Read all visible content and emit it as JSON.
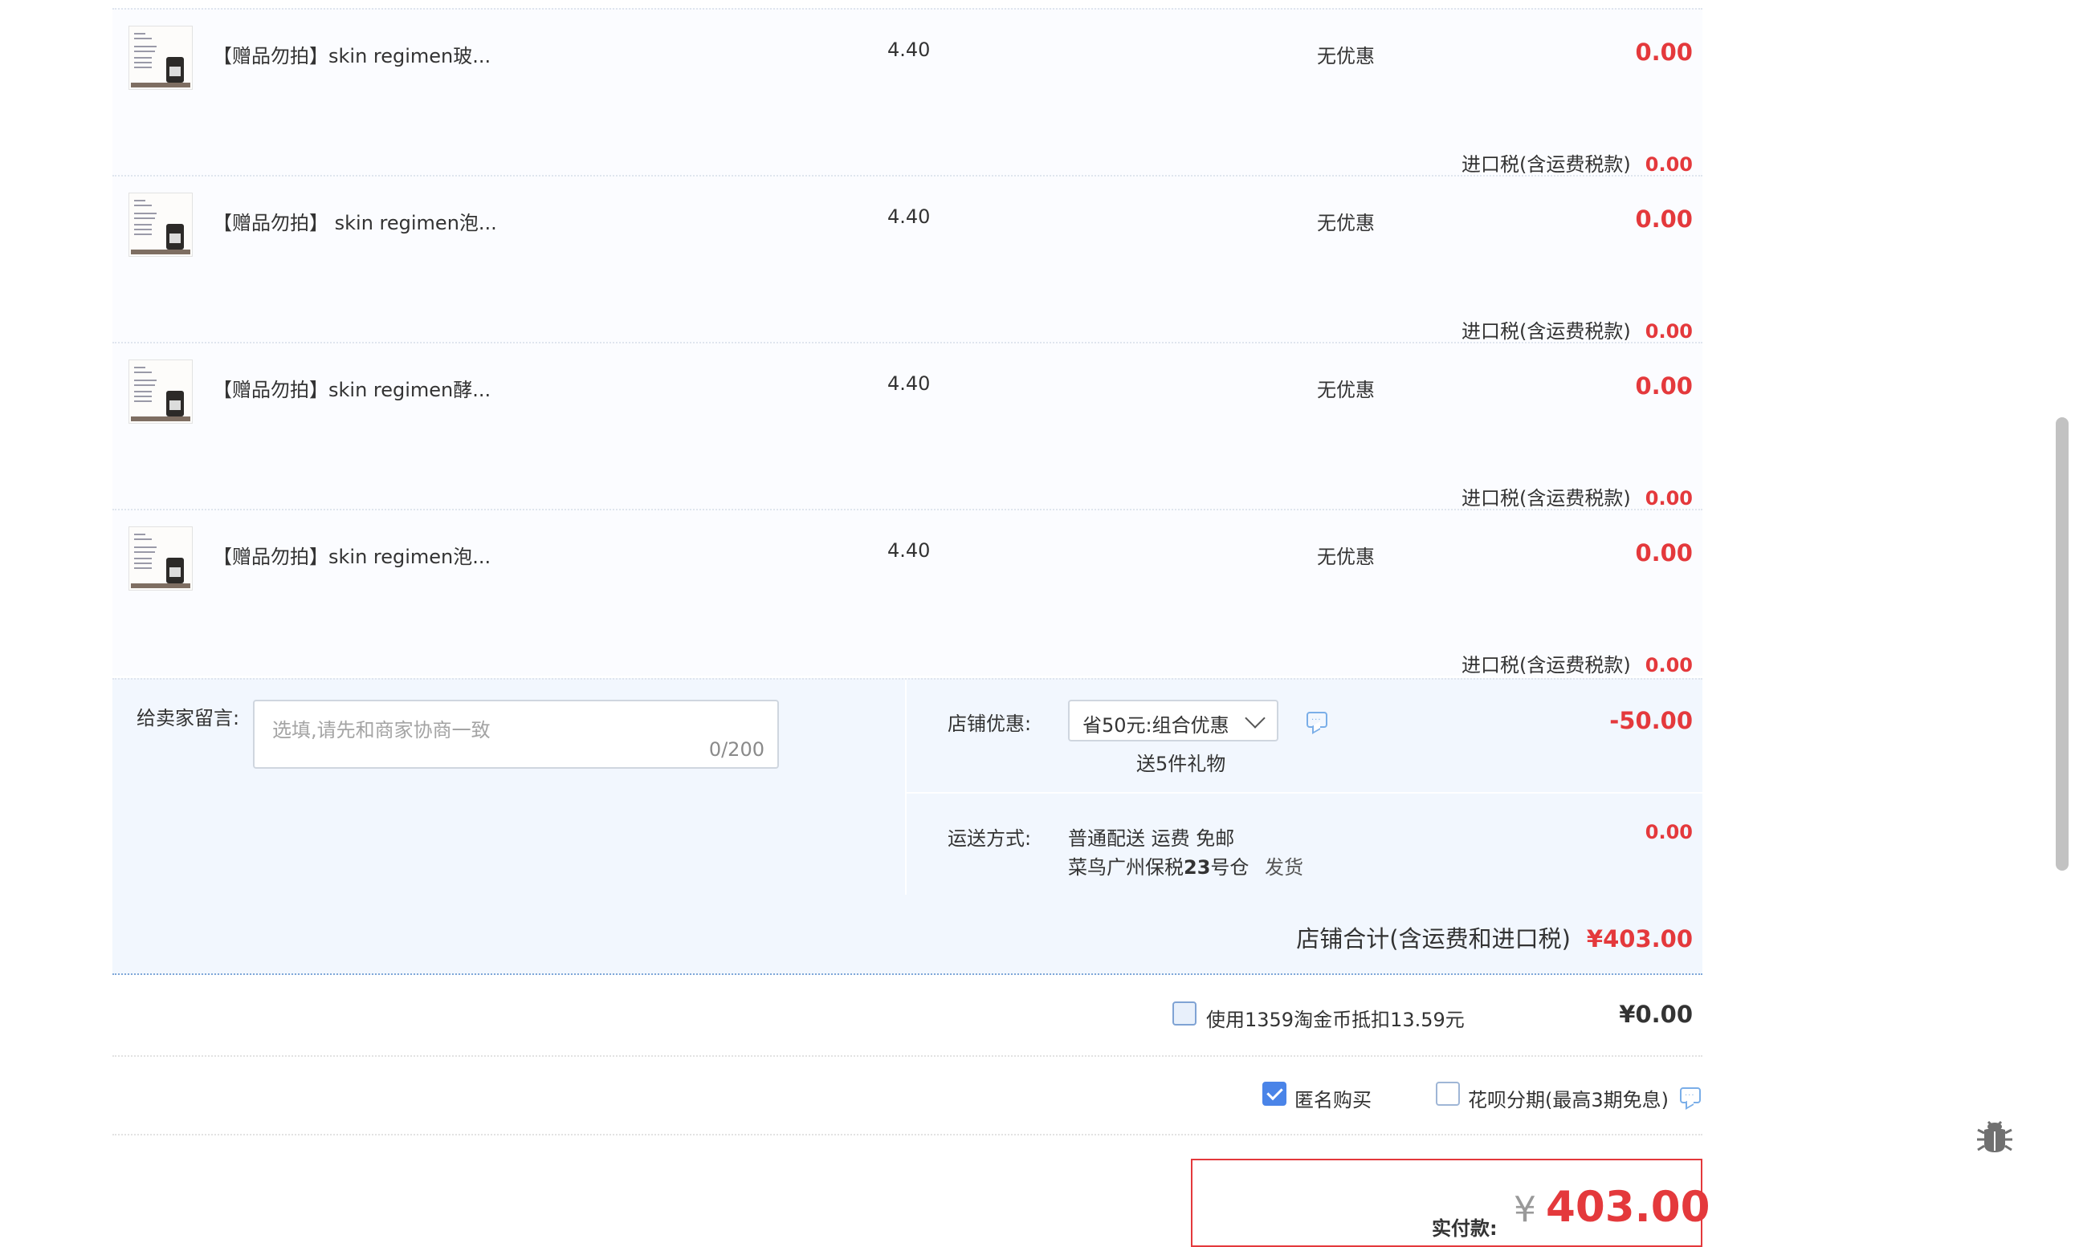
{
  "items": [
    {
      "title": "【赠品勿拍】skin regimen玻...",
      "price": "4.40",
      "promo": "无优惠",
      "subtotal": "0.00",
      "tax_label": "进口税(含运费税款)",
      "tax_value": "0.00"
    },
    {
      "title": "【赠品勿拍】 skin regimen泡...",
      "price": "4.40",
      "promo": "无优惠",
      "subtotal": "0.00",
      "tax_label": "进口税(含运费税款)",
      "tax_value": "0.00"
    },
    {
      "title": "【赠品勿拍】skin regimen酵...",
      "price": "4.40",
      "promo": "无优惠",
      "subtotal": "0.00",
      "tax_label": "进口税(含运费税款)",
      "tax_value": "0.00"
    },
    {
      "title": "【赠品勿拍】skin regimen泡...",
      "price": "4.40",
      "promo": "无优惠",
      "subtotal": "0.00",
      "tax_label": "进口税(含运费税款)",
      "tax_value": "0.00"
    }
  ],
  "message": {
    "label": "给卖家留言:",
    "placeholder": "选填,请先和商家协商一致",
    "counter": "0/200"
  },
  "store_discount": {
    "label": "店铺优惠:",
    "selected": "省50元:组合优惠",
    "gift": "送5件礼物",
    "value": "-50.00"
  },
  "shipping": {
    "label": "运送方式:",
    "method": "普通配送 运费 免邮",
    "warehouse_prefix": "菜鸟广州保税",
    "warehouse_num": "23",
    "warehouse_suffix": "号仓",
    "ship_text": "发货",
    "value": "0.00"
  },
  "store_total": {
    "label": "店铺合计(含运费和进口税)",
    "value": "¥403.00"
  },
  "coins": {
    "label": "使用1359淘金币抵扣13.59元",
    "value": "¥0.00"
  },
  "options": {
    "anonymous_label": "匿名购买",
    "anonymous_checked": true,
    "huabei_label": "花呗分期(最高3期免息)",
    "huabei_checked": false
  },
  "payment": {
    "label": "实付款:",
    "currency": "¥",
    "amount": "403.00"
  },
  "colors": {
    "accent_red": "#e4393c",
    "checkbox_blue": "#4a84e8",
    "store_bg": "#f2f7fe"
  },
  "icons": {
    "chat": "chat-bubble-icon",
    "bug": "bug-icon"
  }
}
